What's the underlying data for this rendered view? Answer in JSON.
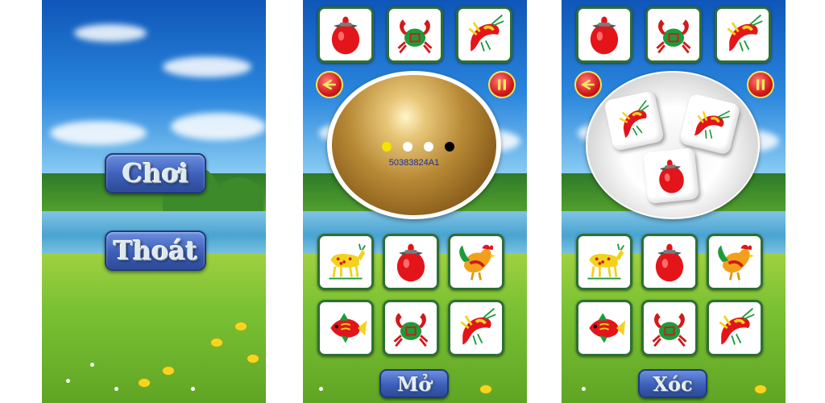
{
  "menu_screen": {
    "play_label": "Chơi",
    "exit_label": "Thoát"
  },
  "game_screen": {
    "top_tiles": [
      "gourd",
      "crab",
      "shrimp"
    ],
    "bottom_tiles": [
      "deer",
      "gourd",
      "rooster",
      "fish",
      "crab",
      "shrimp"
    ],
    "back_icon": "back-arrow-icon",
    "pause_icon": "pause-icon",
    "indicator_dots": [
      "#f4e400",
      "#ffffff",
      "#ffffff",
      "#000000"
    ],
    "code": "50383824A1",
    "open_label": "Mở"
  },
  "shake_screen": {
    "top_tiles": [
      "gourd",
      "crab",
      "shrimp"
    ],
    "bottom_tiles": [
      "deer",
      "gourd",
      "rooster",
      "fish",
      "crab",
      "shrimp"
    ],
    "dice": [
      "shrimp",
      "shrimp",
      "gourd"
    ],
    "shake_label": "Xóc"
  },
  "colors": {
    "tile_border": "#2f6f34",
    "button_blue": "#3d5fb8",
    "round_button_red": "#d11a1a"
  }
}
